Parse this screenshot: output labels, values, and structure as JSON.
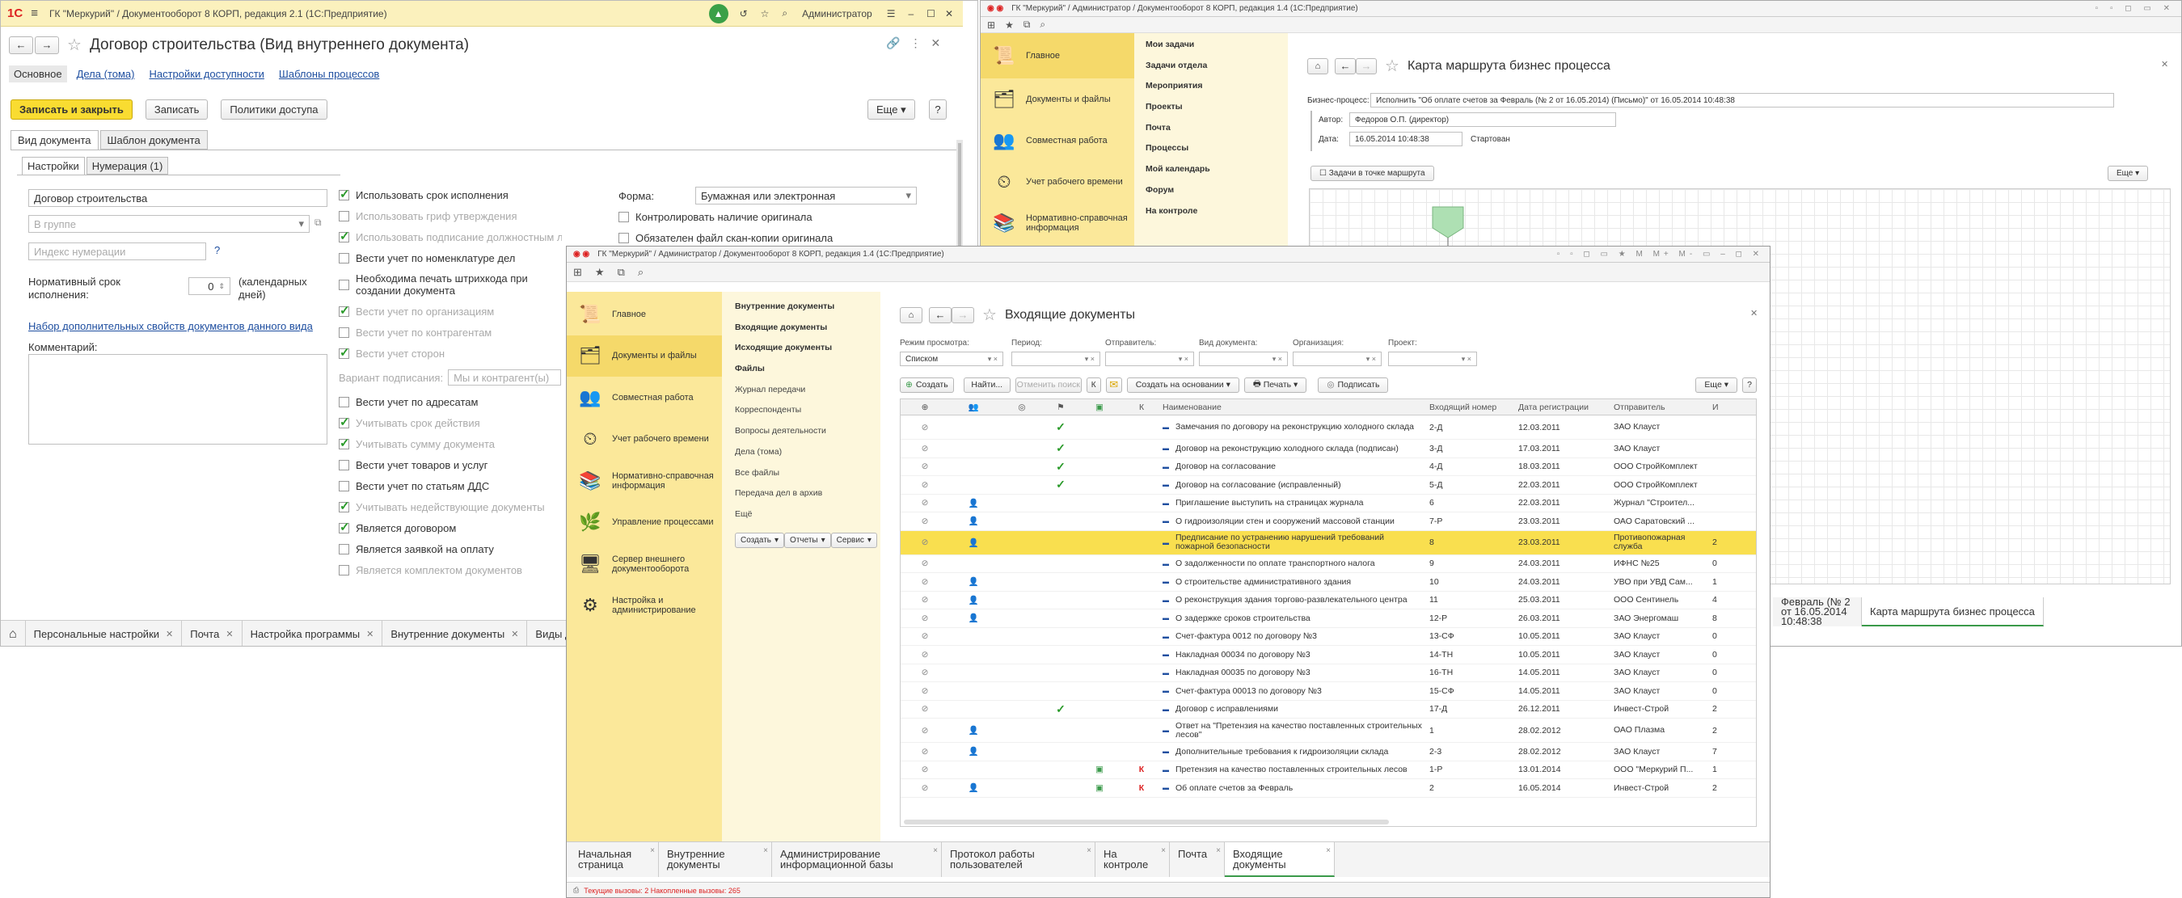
{
  "w1": {
    "title": "ГК \"Меркурий\" / Документооборот 8 КОРП, редакция 2.1  (1С:Предприятие)",
    "user": "Администратор",
    "heading": "Договор строительства (Вид внутреннего документа)",
    "nav": [
      "Основное",
      "Дела (тома)",
      "Настройки доступности",
      "Шаблоны процессов"
    ],
    "buttons": {
      "save_close": "Записать и закрыть",
      "save": "Записать",
      "policies": "Политики доступа",
      "more": "Еще",
      "help": "?"
    },
    "tabs": [
      "Вид документа",
      "Шаблон документа"
    ],
    "subtabs": [
      "Настройки",
      "Нумерация (1)"
    ],
    "name_value": "Договор строительства",
    "group_ph": "В группе",
    "index_ph": "Индекс нумерации",
    "help_mark": "?",
    "term_label": "Нормативный срок исполнения:",
    "term_value": "0",
    "term_unit": "(календарных дней)",
    "props_link": "Набор дополнительных свойств документов данного вида",
    "comment_label": "Комментарий:",
    "checks": [
      {
        "t": "Использовать срок исполнения",
        "on": true,
        "dim": false
      },
      {
        "t": "Использовать гриф утверждения",
        "on": false,
        "dim": true
      },
      {
        "t": "Использовать подписание должностным лицом",
        "on": true,
        "dim": true
      },
      {
        "t": "Вести учет по номенклатуре дел",
        "on": false,
        "dim": false
      },
      {
        "t": "Необходима печать штрихкода при создании документа",
        "on": false,
        "dim": false
      },
      {
        "t": "Вести учет по организациям",
        "on": true,
        "dim": true
      },
      {
        "t": "Вести учет по контрагентам",
        "on": false,
        "dim": true
      },
      {
        "t": "Вести учет сторон",
        "on": true,
        "dim": true
      }
    ],
    "sign_label": "Вариант подписания:",
    "sign_value": "Мы и контрагент(ы)",
    "checks2": [
      {
        "t": "Вести учет по адресатам",
        "on": false,
        "dim": false
      },
      {
        "t": "Учитывать срок действия",
        "on": true,
        "dim": true
      },
      {
        "t": "Учитывать сумму документа",
        "on": true,
        "dim": true
      },
      {
        "t": "Вести учет товаров и услуг",
        "on": false,
        "dim": false
      },
      {
        "t": "Вести учет по статьям ДДС",
        "on": false,
        "dim": false
      },
      {
        "t": "Учитывать недействующие документы",
        "on": true,
        "dim": true
      },
      {
        "t": "Является договором",
        "on": true,
        "dim": false
      },
      {
        "t": "Является заявкой на оплату",
        "on": false,
        "dim": false
      },
      {
        "t": "Является комплектом документов",
        "on": false,
        "dim": true
      }
    ],
    "form_label": "Форма:",
    "form_value": "Бумажная или электронная",
    "form_checks": [
      "Контролировать наличие оригинала",
      "Обязателен файл скан-копии оригинала"
    ],
    "bottom_tabs": [
      "Персональные настройки",
      "Почта",
      "Настройка программы",
      "Внутренние документы",
      "Виды док"
    ]
  },
  "w2": {
    "title": "ГК \"Меркурий\" / Администратор / Документооборот 8 КОРП, редакция 1.4  (1С:Предприятие)",
    "sections": [
      "Главное",
      "Документы и файлы",
      "Совместная работа",
      "Учет рабочего времени",
      "Нормативно-справочная информация"
    ],
    "menu": [
      "Мои задачи",
      "Задачи отдела",
      "Мероприятия",
      "Проекты",
      "Почта",
      "Процессы",
      "Мой календарь",
      "Форум",
      "На контроле"
    ],
    "heading": "Карта маршрута бизнес процесса",
    "bp_label": "Бизнес-процесс:",
    "bp_value": "Исполнить \"Об оплате счетов за Февраль (№ 2 от 16.05.2014) (Письмо)\" от 16.05.2014 10:48:38",
    "author_label": "Автор:",
    "author_value": "Федоров О.П. (директор)",
    "date_label": "Дата:",
    "date_value": "16.05.2014 10:48:38",
    "state": "Стартован",
    "tasks_btn": "Задачи в точке маршрута",
    "more": "Еще",
    "bottom_tabs": [
      "Февраль (№ 2 от 16.05.2014 10:48:38",
      "Карта маршрута бизнес процесса"
    ]
  },
  "w3": {
    "title": "ГК \"Меркурий\" / Администратор / Документооборот 8 КОРП, редакция 1.4  (1С:Предприятие)",
    "sections": [
      "Главное",
      "Документы и файлы",
      "Совместная работа",
      "Учет рабочего времени",
      "Нормативно-справочная информация",
      "Управление процессами",
      "Сервер внешнего документооборота",
      "Настройка и администрирование"
    ],
    "menu": [
      {
        "t": "Внутренние документы",
        "b": true
      },
      {
        "t": "Входящие документы",
        "b": true
      },
      {
        "t": "Исходящие документы",
        "b": true
      },
      {
        "t": "Файлы",
        "b": true
      },
      {
        "t": "Журнал передачи",
        "b": false
      },
      {
        "t": "Корреспонденты",
        "b": false
      },
      {
        "t": "Вопросы деятельности",
        "b": false
      },
      {
        "t": "Дела (тома)",
        "b": false
      },
      {
        "t": "Все файлы",
        "b": false
      },
      {
        "t": "Передача дел в архив",
        "b": false
      }
    ],
    "menu_more": "Ещё",
    "menu_drop": [
      "Создать",
      "Отчеты",
      "Сервис"
    ],
    "heading": "Входящие документы",
    "filters": [
      {
        "label": "Режим просмотра:",
        "value": "Списком"
      },
      {
        "label": "Период:",
        "value": ""
      },
      {
        "label": "Отправитель:",
        "value": ""
      },
      {
        "label": "Вид документа:",
        "value": ""
      },
      {
        "label": "Организация:",
        "value": ""
      },
      {
        "label": "Проект:",
        "value": ""
      }
    ],
    "tools": {
      "create": "Создать",
      "find": "Найти...",
      "cancel": "Отменить поиск",
      "k": "К",
      "create_based": "Создать на основании",
      "print": "Печать",
      "sign": "Подписать",
      "more": "Еще",
      "help": "?"
    },
    "columns": [
      "Наименование",
      "Входящий номер",
      "Дата регистрации",
      "Отправитель",
      "И"
    ],
    "rows": [
      {
        "n": "Замечания по договору на реконструкцию холодного склада",
        "num": "2-Д",
        "date": "12.03.2011",
        "from": "ЗАО Клауст",
        "x": "",
        "chk": true,
        "av": false,
        "k": false,
        "hl": false,
        "tall": true
      },
      {
        "n": "Договор на реконструкцию холодного склада (подписан)",
        "num": "3-Д",
        "date": "17.03.2011",
        "from": "ЗАО Клауст",
        "x": "",
        "chk": true,
        "av": false,
        "k": false,
        "hl": false,
        "tall": false
      },
      {
        "n": "Договор на согласование",
        "num": "4-Д",
        "date": "18.03.2011",
        "from": "ООО СтройКомплект",
        "x": "",
        "chk": true,
        "av": false,
        "k": false,
        "hl": false,
        "tall": false
      },
      {
        "n": "Договор на согласование (исправленный)",
        "num": "5-Д",
        "date": "22.03.2011",
        "from": "ООО СтройКомплект",
        "x": "",
        "chk": true,
        "av": false,
        "k": false,
        "hl": false,
        "tall": false
      },
      {
        "n": "Приглашение выступить на страницах журнала",
        "num": "6",
        "date": "22.03.2011",
        "from": "Журнал \"Строител...",
        "x": "",
        "chk": false,
        "av": true,
        "k": false,
        "hl": false,
        "tall": false
      },
      {
        "n": "О гидроизоляции стен и сооружений массовой станции",
        "num": "7-Р",
        "date": "23.03.2011",
        "from": "ОАО Саратовский ...",
        "x": "",
        "chk": false,
        "av": true,
        "k": false,
        "hl": false,
        "tall": false
      },
      {
        "n": "Предписание по устранению нарушений требований пожарной безопасности",
        "num": "8",
        "date": "23.03.2011",
        "from": "Противопожарная служба",
        "x": "2",
        "chk": false,
        "av": true,
        "k": false,
        "hl": true,
        "tall": true
      },
      {
        "n": "О задолженности по оплате транспортного налога",
        "num": "9",
        "date": "24.03.2011",
        "from": "ИФНС №25",
        "x": "0",
        "chk": false,
        "av": false,
        "k": false,
        "hl": false,
        "tall": false
      },
      {
        "n": "О строительстве административного здания",
        "num": "10",
        "date": "24.03.2011",
        "from": "УВО при УВД Сам...",
        "x": "1",
        "chk": false,
        "av": true,
        "k": false,
        "hl": false,
        "tall": false
      },
      {
        "n": "О реконструкция здания торгово-развлекательного центра",
        "num": "11",
        "date": "25.03.2011",
        "from": "ООО Сентинель",
        "x": "4",
        "chk": false,
        "av": true,
        "k": false,
        "hl": false,
        "tall": false
      },
      {
        "n": "О задержке сроков строительства",
        "num": "12-Р",
        "date": "26.03.2011",
        "from": "ЗАО Энергомаш",
        "x": "8",
        "chk": false,
        "av": true,
        "k": false,
        "hl": false,
        "tall": false
      },
      {
        "n": "Счет-фактура 0012 по договору №3",
        "num": "13-СФ",
        "date": "10.05.2011",
        "from": "ЗАО Клауст",
        "x": "0",
        "chk": false,
        "av": false,
        "k": false,
        "hl": false,
        "tall": false
      },
      {
        "n": "Накладная 00034 по договору №3",
        "num": "14-ТН",
        "date": "10.05.2011",
        "from": "ЗАО Клауст",
        "x": "0",
        "chk": false,
        "av": false,
        "k": false,
        "hl": false,
        "tall": false
      },
      {
        "n": "Накладная 00035 по договору №3",
        "num": "16-ТН",
        "date": "14.05.2011",
        "from": "ЗАО Клауст",
        "x": "0",
        "chk": false,
        "av": false,
        "k": false,
        "hl": false,
        "tall": false
      },
      {
        "n": "Счет-фактура 00013 по договору №3",
        "num": "15-СФ",
        "date": "14.05.2011",
        "from": "ЗАО Клауст",
        "x": "0",
        "chk": false,
        "av": false,
        "k": false,
        "hl": false,
        "tall": false
      },
      {
        "n": "Договор с исправлениями",
        "num": "17-Д",
        "date": "26.12.2011",
        "from": "Инвест-Строй",
        "x": "2",
        "chk": true,
        "av": false,
        "k": false,
        "hl": false,
        "tall": false
      },
      {
        "n": "Ответ на \"Претензия на качество поставленных строительных лесов\"",
        "num": "1",
        "date": "28.02.2012",
        "from": "ОАО Плазма",
        "x": "2",
        "chk": false,
        "av": true,
        "k": false,
        "hl": false,
        "tall": true
      },
      {
        "n": "Дополнительные требования к гидроизоляции склада",
        "num": "2-3",
        "date": "28.02.2012",
        "from": "ЗАО Клауст",
        "x": "7",
        "chk": false,
        "av": true,
        "k": false,
        "hl": false,
        "tall": false
      },
      {
        "n": "Претензия на качество поставленных строительных лесов",
        "num": "1-Р",
        "date": "13.01.2014",
        "from": "ООО \"Меркурий П...",
        "x": "1",
        "chk": false,
        "av": false,
        "k": true,
        "hl": false,
        "tall": false
      },
      {
        "n": "Об оплате счетов за Февраль",
        "num": "2",
        "date": "16.05.2014",
        "from": "Инвест-Строй",
        "x": "2",
        "chk": false,
        "av": true,
        "k": true,
        "hl": false,
        "tall": false
      }
    ],
    "bottom_tabs": [
      "Начальная страница",
      "Внутренние документы",
      "Администрирование информационной базы",
      "Протокол работы пользователей",
      "На контроле",
      "Почта",
      "Входящие документы"
    ],
    "status": "Текущие вызовы: 2   Накопленные вызовы: 265"
  }
}
